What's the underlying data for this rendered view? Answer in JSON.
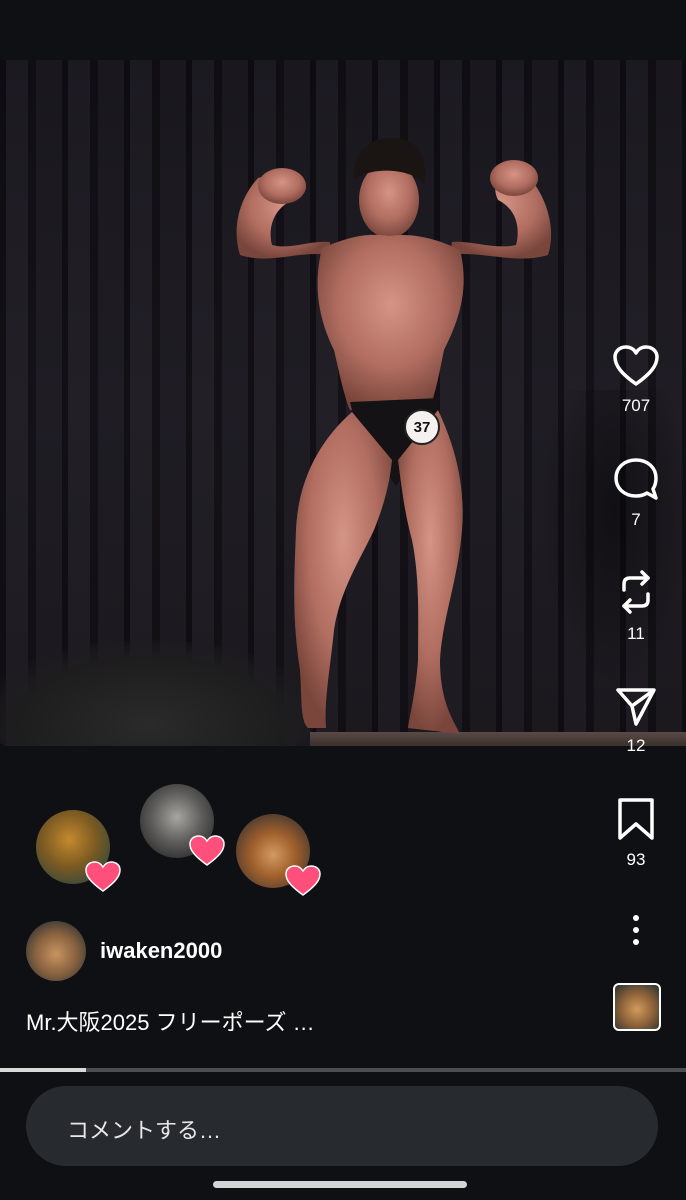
{
  "video": {
    "bib_number": "37",
    "progress": 0.125
  },
  "actions": {
    "like_count": "707",
    "comment_count": "7",
    "repost_count": "11",
    "share_count": "12",
    "save_count": "93"
  },
  "icons": {
    "like": "heart-icon",
    "comment": "comment-bubble-icon",
    "repost": "repost-icon",
    "share": "send-icon",
    "save": "bookmark-icon",
    "more": "more-vertical-icon"
  },
  "post": {
    "username": "iwaken2000",
    "caption": "Mr.大阪2025 フリーポーズ …"
  },
  "comment_box": {
    "placeholder": "コメントする…"
  },
  "colors": {
    "background": "#0e1013",
    "heart_badge": "#ff4f7a",
    "input_bg": "#272a2f"
  }
}
